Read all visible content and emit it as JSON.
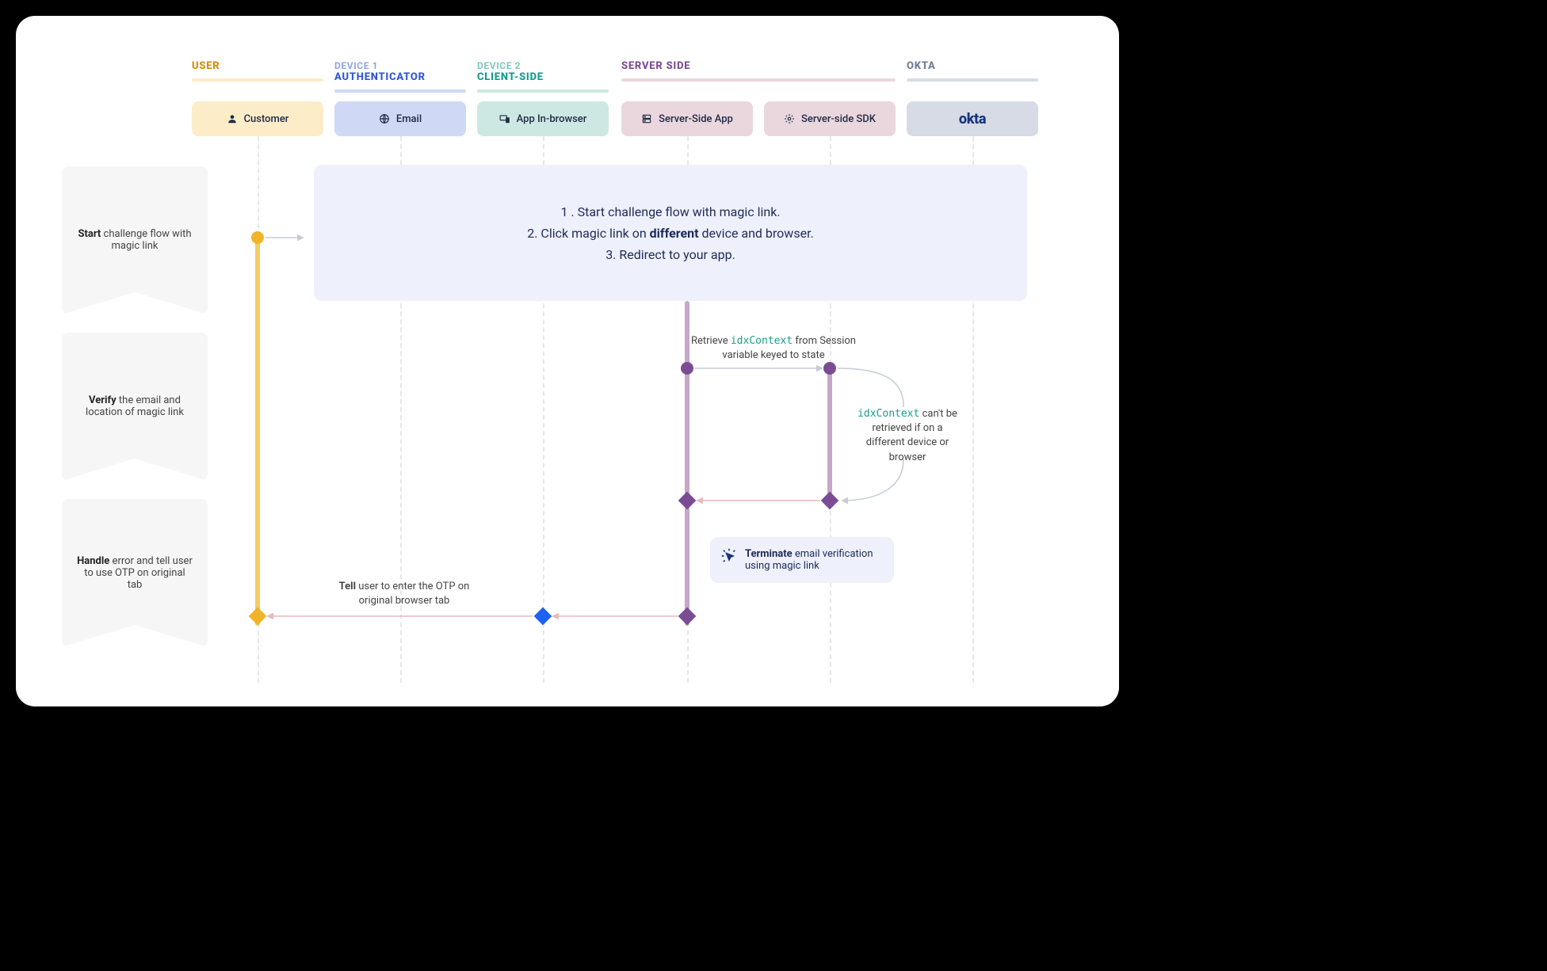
{
  "columns": {
    "user": {
      "line2": "USER",
      "box": "Customer",
      "color": "#d88b00",
      "bg": "#fdecc8",
      "rule": "#fdecc8"
    },
    "auth": {
      "line1": "DEVICE 1",
      "line2": "AUTHENTICATOR",
      "box": "Email",
      "color": "#2f55d4",
      "bg": "#cfd9f5",
      "rule": "#cfd9f5"
    },
    "client": {
      "line1": "DEVICE 2",
      "line2": "CLIENT-SIDE",
      "box": "App In-browser",
      "color": "#0f9b8e",
      "bg": "#cde8e2",
      "rule": "#cde8e2"
    },
    "server": {
      "line2": "SERVER SIDE",
      "box1": "Server-Side App",
      "box2": "Server-side SDK",
      "color": "#7b4b94",
      "bg": "#ead7dd",
      "rule": "#ead7dd"
    },
    "okta": {
      "line2": "OKTA",
      "color": "#6f7b94",
      "bg": "#d6dbe6",
      "rule": "#d6dbe6"
    }
  },
  "steps": {
    "start": {
      "b": "Start",
      "rest": " challenge flow with magic link"
    },
    "verify": {
      "b": "Verify",
      "rest": " the email and location of magic link"
    },
    "handle": {
      "b": "Handle",
      "rest": " error and tell user to use OTP on original tab"
    }
  },
  "panel": {
    "l1a": "1 .  Start challenge flow with magic link.",
    "l2a": "2. Click magic link on ",
    "l2b": "different",
    "l2c": " device and browser.",
    "l3a": "3. Redirect to your app."
  },
  "retrieve": {
    "pre": "Retrieve ",
    "code": "idxContext",
    "post": " from Session variable keyed to state"
  },
  "cant": {
    "code": "idxContext",
    "post": " can't be retrieved if on a different device or browser"
  },
  "terminate": {
    "b": "Terminate",
    "rest": " email verification using magic link"
  },
  "tell": {
    "b": "Tell",
    "rest": " user to enter the OTP on original browser tab"
  }
}
